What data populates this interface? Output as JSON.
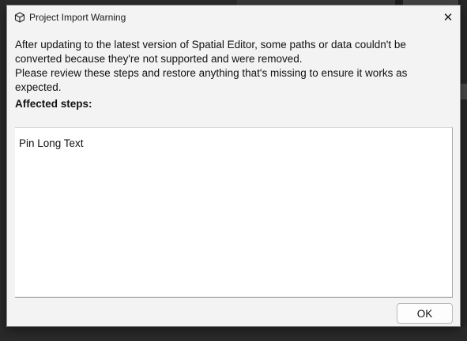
{
  "dialog": {
    "title": "Project Import Warning",
    "close_icon": "close-icon",
    "title_icon": "cube-icon",
    "close_glyph": "✕",
    "message_line1": "After updating to the latest version of Spatial Editor, some paths or data couldn't be converted because they're not supported and were removed.",
    "message_line2": "Please review these steps and restore anything that's missing to ensure it works as expected.",
    "affected_label": "Affected steps:",
    "steps": [
      "Pin Long Text"
    ],
    "ok_label": "OK"
  },
  "colors": {
    "dialog_bg": "#f3f3f3",
    "list_bg": "#ffffff",
    "background_app": "#2d2d2d"
  }
}
